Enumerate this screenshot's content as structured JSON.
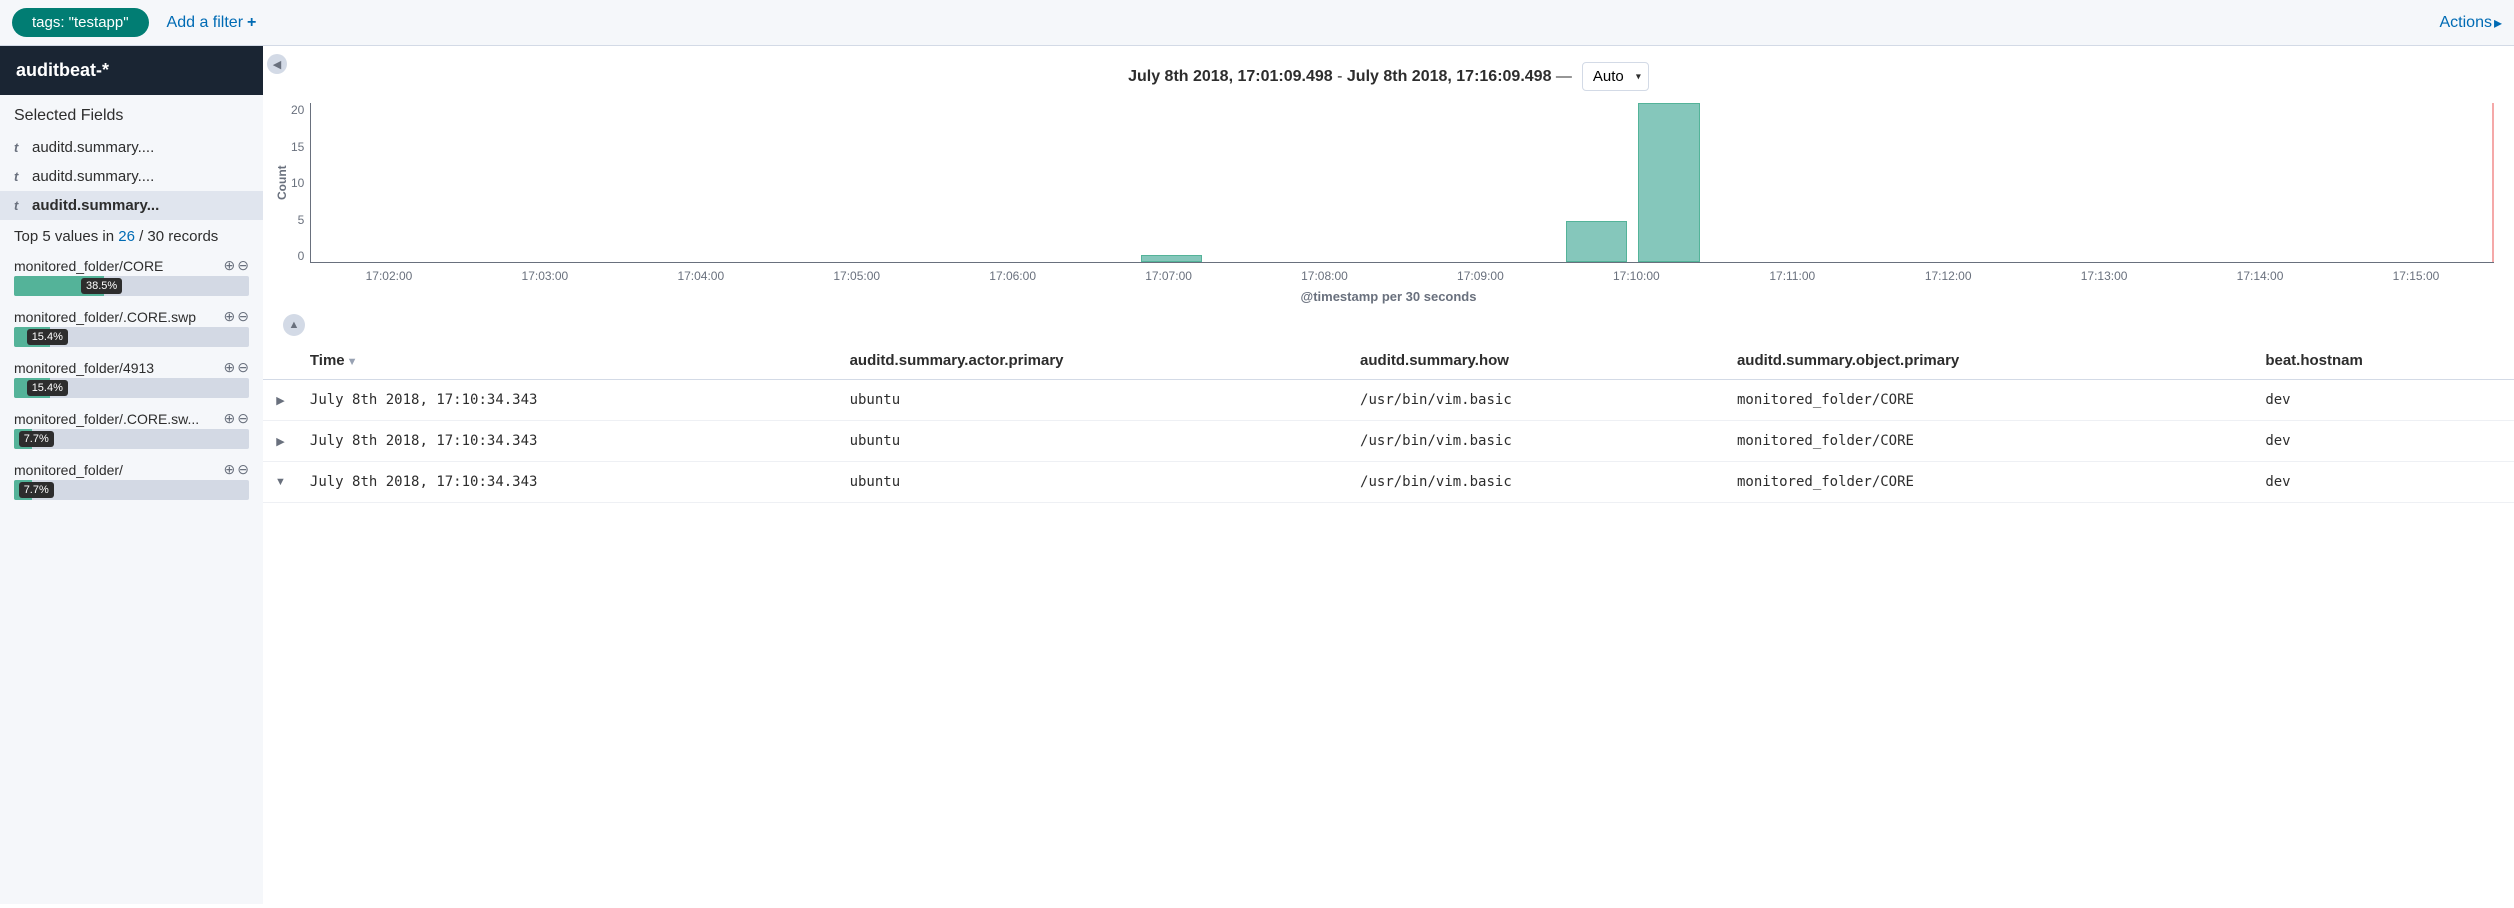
{
  "topbar": {
    "filter_pill": "tags: \"testapp\"",
    "add_filter": "Add a filter",
    "actions": "Actions"
  },
  "sidebar": {
    "index_pattern": "auditbeat-*",
    "selected_title": "Selected Fields",
    "selected_fields": [
      {
        "type": "t",
        "name": "auditd.summary...."
      },
      {
        "type": "t",
        "name": "auditd.summary...."
      },
      {
        "type": "t",
        "name": "auditd.summary...",
        "active": true
      }
    ],
    "topvals": {
      "prefix": "Top 5 values in ",
      "count": "26",
      "suffix": " / 30 records"
    },
    "values": [
      {
        "label": "monitored_folder/CORE",
        "pct": 38.5
      },
      {
        "label": "monitored_folder/.CORE.swp",
        "pct": 15.4
      },
      {
        "label": "monitored_folder/4913",
        "pct": 15.4
      },
      {
        "label": "monitored_folder/.CORE.sw...",
        "pct": 7.7
      },
      {
        "label": "monitored_folder/",
        "pct": 7.7
      }
    ]
  },
  "timerange": {
    "from": "July 8th 2018, 17:01:09.498",
    "to": "July 8th 2018, 17:16:09.498",
    "interval_selected": "Auto"
  },
  "chart_data": {
    "type": "bar",
    "ylabel": "Count",
    "xlabel": "@timestamp per 30 seconds",
    "yticks": [
      20,
      15,
      10,
      5,
      0
    ],
    "xticks": [
      "17:02:00",
      "17:03:00",
      "17:04:00",
      "17:05:00",
      "17:06:00",
      "17:07:00",
      "17:08:00",
      "17:09:00",
      "17:10:00",
      "17:11:00",
      "17:12:00",
      "17:13:00",
      "17:14:00",
      "17:15:00"
    ],
    "ylim": [
      0,
      23
    ],
    "bars": [
      {
        "x_pct": 38.0,
        "value": 1
      },
      {
        "x_pct": 57.5,
        "value": 6
      },
      {
        "x_pct": 60.8,
        "value": 23
      }
    ]
  },
  "table": {
    "columns": [
      "Time",
      "auditd.summary.actor.primary",
      "auditd.summary.how",
      "auditd.summary.object.primary",
      "beat.hostnam"
    ],
    "rows": [
      {
        "expanded": false,
        "time": "July 8th 2018, 17:10:34.343",
        "actor": "ubuntu",
        "how": "/usr/bin/vim.basic",
        "object": "monitored_folder/CORE",
        "host": "dev"
      },
      {
        "expanded": false,
        "time": "July 8th 2018, 17:10:34.343",
        "actor": "ubuntu",
        "how": "/usr/bin/vim.basic",
        "object": "monitored_folder/CORE",
        "host": "dev"
      },
      {
        "expanded": true,
        "time": "July 8th 2018, 17:10:34.343",
        "actor": "ubuntu",
        "how": "/usr/bin/vim.basic",
        "object": "monitored_folder/CORE",
        "host": "dev"
      }
    ]
  }
}
